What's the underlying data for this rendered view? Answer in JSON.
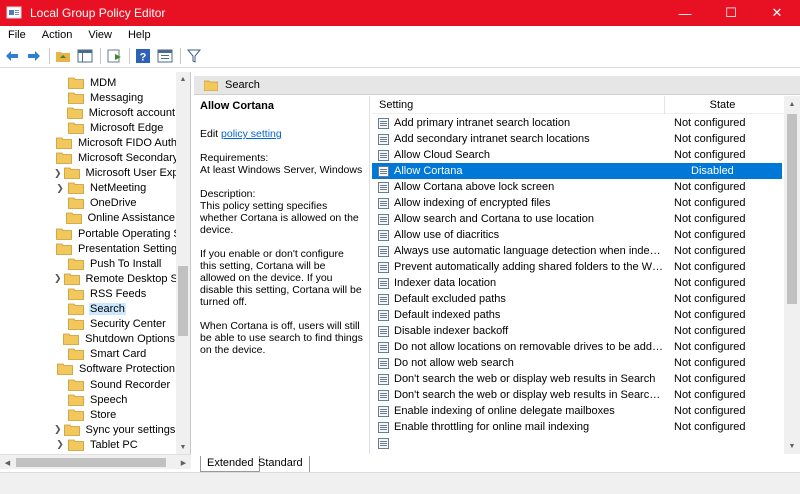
{
  "window": {
    "title": "Local Group Policy Editor",
    "accent_color": "#e81123",
    "controls": {
      "minimize": "—",
      "maximize": "☐",
      "close": "✕"
    }
  },
  "menu": [
    "File",
    "Action",
    "View",
    "Help"
  ],
  "toolbar": {
    "icons": [
      "back-arrow-icon",
      "forward-arrow-icon",
      "up-folder-icon",
      "show-hide-tree-icon",
      "export-list-icon",
      "help-icon",
      "properties-icon",
      "filter-icon"
    ]
  },
  "tree": {
    "items": [
      {
        "label": "MDM",
        "expandable": false
      },
      {
        "label": "Messaging",
        "expandable": false
      },
      {
        "label": "Microsoft account",
        "expandable": false
      },
      {
        "label": "Microsoft Edge",
        "expandable": false
      },
      {
        "label": "Microsoft FIDO Auth",
        "expandable": false
      },
      {
        "label": "Microsoft Secondary",
        "expandable": false
      },
      {
        "label": "Microsoft User Expe",
        "expandable": true
      },
      {
        "label": "NetMeeting",
        "expandable": true
      },
      {
        "label": "OneDrive",
        "expandable": false
      },
      {
        "label": "Online Assistance",
        "expandable": false
      },
      {
        "label": "Portable Operating S",
        "expandable": false
      },
      {
        "label": "Presentation Setting",
        "expandable": false
      },
      {
        "label": "Push To Install",
        "expandable": false
      },
      {
        "label": "Remote Desktop Ser",
        "expandable": true
      },
      {
        "label": "RSS Feeds",
        "expandable": false
      },
      {
        "label": "Search",
        "expandable": false,
        "selected": true
      },
      {
        "label": "Security Center",
        "expandable": false
      },
      {
        "label": "Shutdown Options",
        "expandable": false
      },
      {
        "label": "Smart Card",
        "expandable": false
      },
      {
        "label": "Software Protection",
        "expandable": false
      },
      {
        "label": "Sound Recorder",
        "expandable": false
      },
      {
        "label": "Speech",
        "expandable": false
      },
      {
        "label": "Store",
        "expandable": false
      },
      {
        "label": "Sync your settings",
        "expandable": true
      },
      {
        "label": "Tablet PC",
        "expandable": true
      }
    ]
  },
  "panel": {
    "header": "Search",
    "description": {
      "policy_name": "Allow Cortana",
      "edit_prefix": "Edit ",
      "edit_link": "policy setting",
      "requirements_label": "Requirements:",
      "requirements": "At least Windows Server, Windows 10",
      "description_label": "Description:",
      "description": "This policy setting specifies whether Cortana is allowed on the device.",
      "paragraph2": "If you enable or don't configure this setting, Cortana will be allowed on the device. If you disable this setting, Cortana will be turned off.",
      "paragraph3": "When Cortana is off, users will still be able to use search to find things on the device."
    },
    "columns": {
      "setting": "Setting",
      "state": "State"
    },
    "rows": [
      {
        "setting": "Add primary intranet search location",
        "state": "Not configured"
      },
      {
        "setting": "Add secondary intranet search locations",
        "state": "Not configured"
      },
      {
        "setting": "Allow Cloud Search",
        "state": "Not configured"
      },
      {
        "setting": "Allow Cortana",
        "state": "Disabled",
        "selected": true
      },
      {
        "setting": "Allow Cortana above lock screen",
        "state": "Not configured"
      },
      {
        "setting": "Allow indexing of encrypted files",
        "state": "Not configured"
      },
      {
        "setting": "Allow search and Cortana to use location",
        "state": "Not configured"
      },
      {
        "setting": "Allow use of diacritics",
        "state": "Not configured"
      },
      {
        "setting": "Always use automatic language detection when indexing co...",
        "state": "Not configured"
      },
      {
        "setting": "Prevent automatically adding shared folders to the Window...",
        "state": "Not configured"
      },
      {
        "setting": "Indexer data location",
        "state": "Not configured"
      },
      {
        "setting": "Default excluded paths",
        "state": "Not configured"
      },
      {
        "setting": "Default indexed paths",
        "state": "Not configured"
      },
      {
        "setting": "Disable indexer backoff",
        "state": "Not configured"
      },
      {
        "setting": "Do not allow locations on removable drives to be added to li...",
        "state": "Not configured"
      },
      {
        "setting": "Do not allow web search",
        "state": "Not configured"
      },
      {
        "setting": "Don't search the web or display web results in Search",
        "state": "Not configured"
      },
      {
        "setting": "Don't search the web or display web results in Search over ...",
        "state": "Not configured"
      },
      {
        "setting": "Enable indexing of online delegate mailboxes",
        "state": "Not configured"
      },
      {
        "setting": "Enable throttling for online mail indexing",
        "state": "Not configured"
      },
      {
        "setting": "",
        "state": ""
      }
    ],
    "selection_color": "#0078d7"
  },
  "tabs": [
    "Extended",
    "Standard"
  ]
}
